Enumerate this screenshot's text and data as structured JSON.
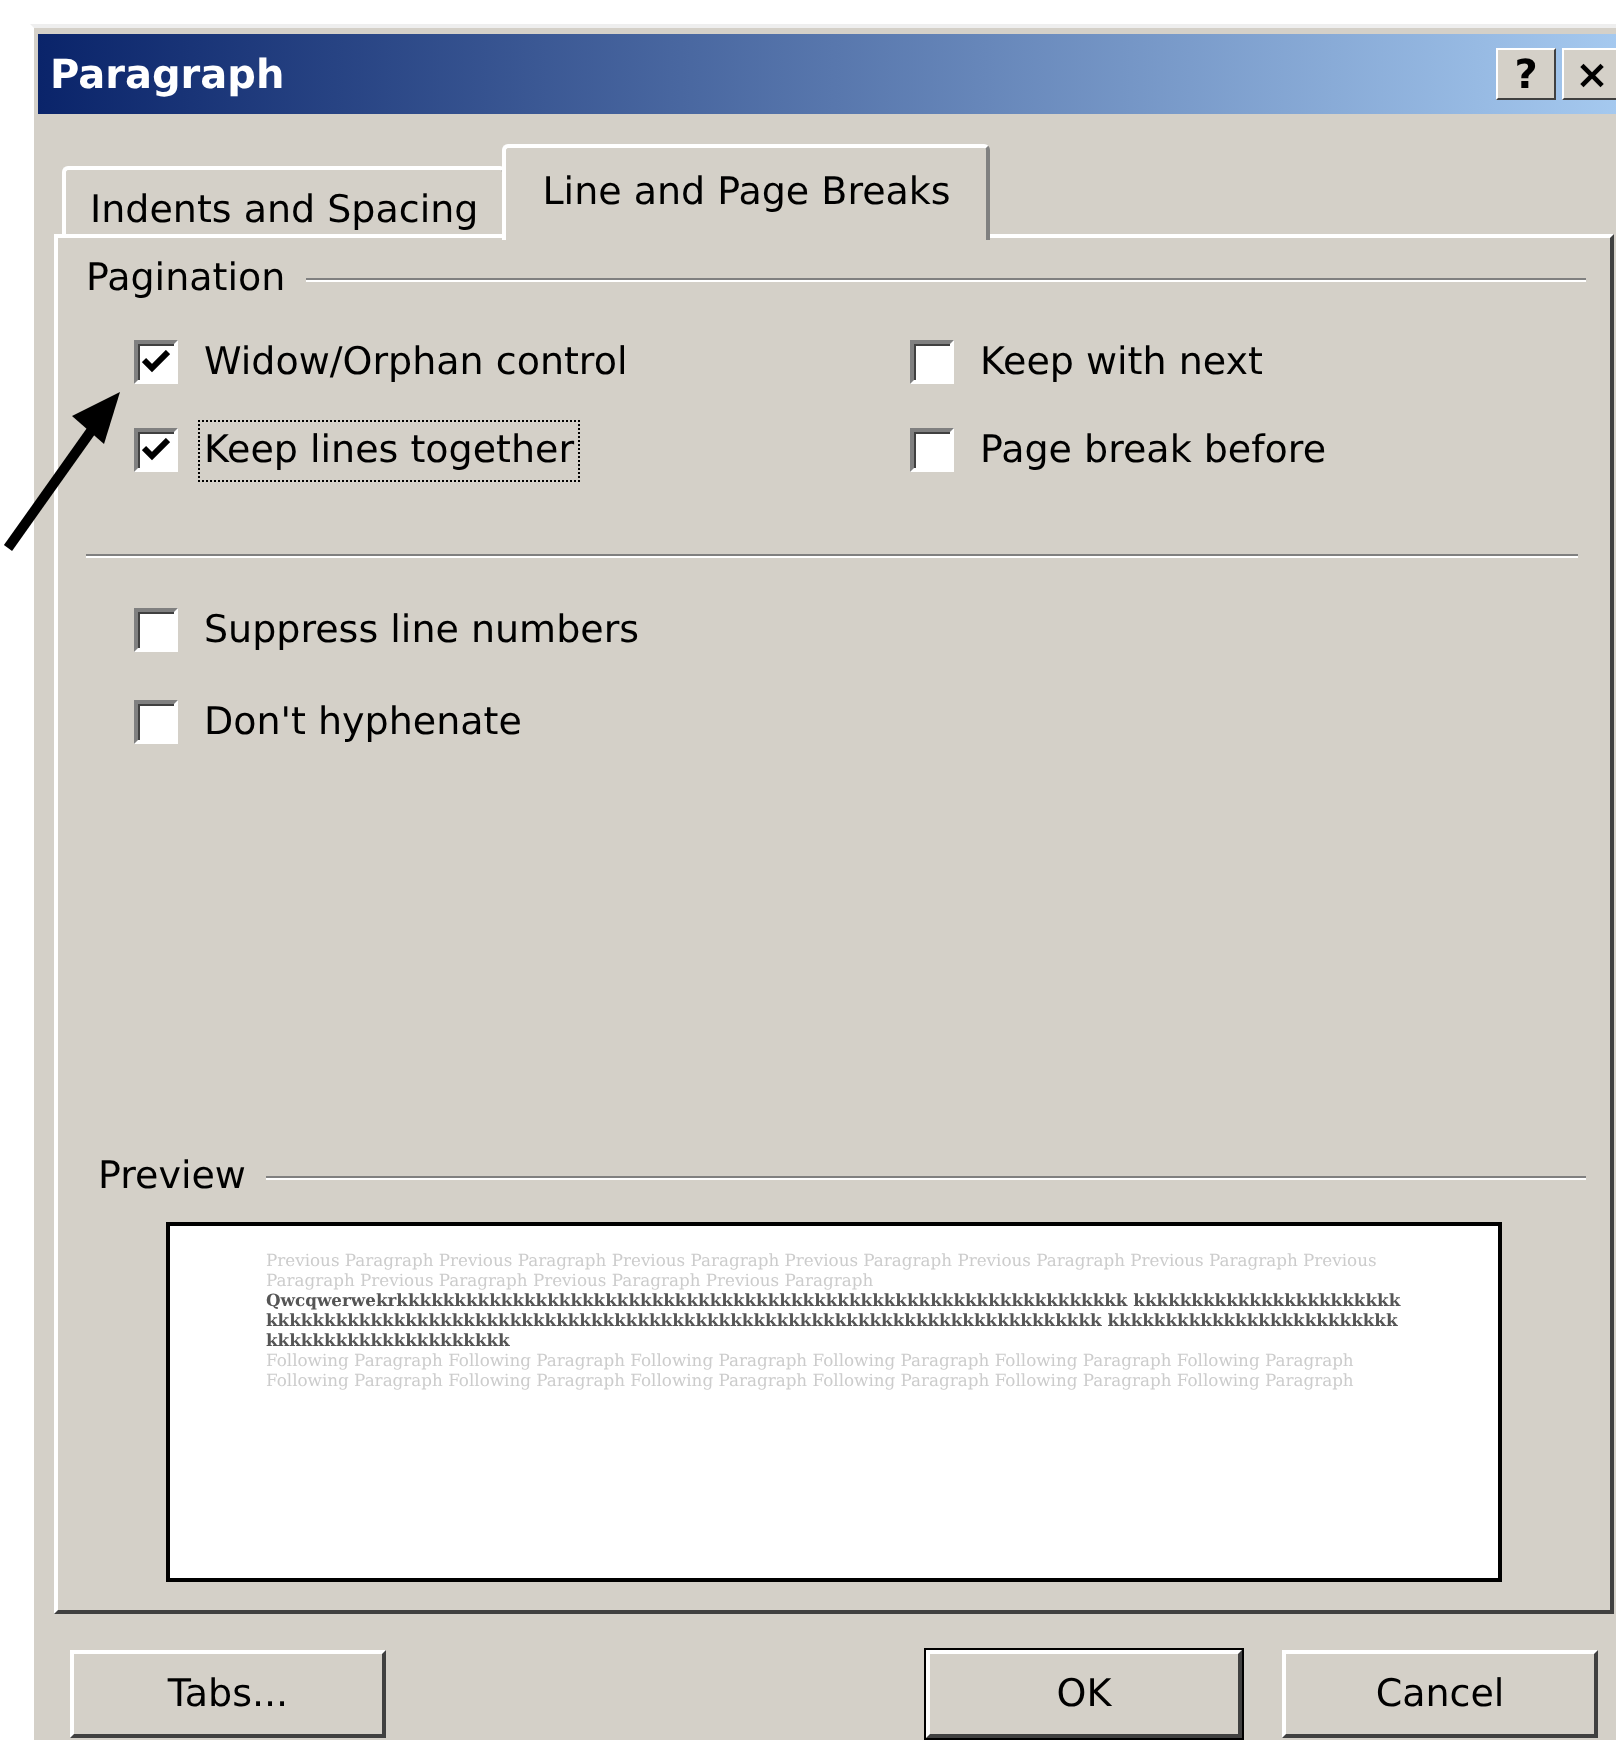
{
  "window": {
    "title": "Paragraph",
    "controls": [
      "?",
      "×"
    ]
  },
  "tabs": [
    {
      "label": "Indents and Spacing",
      "selected": false
    },
    {
      "label": "Line and Page Breaks",
      "selected": true
    }
  ],
  "pagination": {
    "title": "Pagination",
    "options": [
      {
        "label": "Widow/Orphan control",
        "checked": true,
        "focused": false
      },
      {
        "label": "Keep with next",
        "checked": false,
        "focused": false
      },
      {
        "label": "Keep lines together",
        "checked": true,
        "focused": true
      },
      {
        "label": "Page break before",
        "checked": false,
        "focused": false
      }
    ]
  },
  "other_options": [
    {
      "label": "Suppress line numbers",
      "checked": false,
      "focused": false
    },
    {
      "label": "Don't hyphenate",
      "checked": false,
      "focused": false
    }
  ],
  "preview": {
    "title": "Preview",
    "paragraphs": [
      {
        "kind": "previous",
        "text": "Previous Paragraph Previous Paragraph Previous Paragraph Previous Paragraph Previous Paragraph Previous Paragraph Previous Paragraph Previous Paragraph Previous Paragraph Previous Paragraph"
      },
      {
        "kind": "current",
        "text": "Qwcqwerwekrkkkkkkkkkkkkkkkkkkkkkkkkkkkkkkkkkkkkkkkkkkkkkkkkkkkkkkkkkkkkkkk kkkkkkkkkkkkkkkkkkkkkkkkkkkkkkkkkkkkkkkkkkkkkkkkkkkkkkkkkkkkkkkkkkkkkkkkkkkkkkkkkkkkkkkkkkkkkkk kkkkkkkkkkkkkkkkkkkkkkkkkkkkkkkkkkkkkkkkkkkkkk"
      },
      {
        "kind": "following",
        "text": "Following Paragraph Following Paragraph Following Paragraph Following Paragraph Following Paragraph Following Paragraph Following Paragraph Following Paragraph Following Paragraph Following Paragraph Following Paragraph Following Paragraph"
      }
    ]
  },
  "buttons": [
    {
      "label": "Tabs...",
      "default": false
    },
    {
      "label": "OK",
      "default": true
    },
    {
      "label": "Cancel",
      "default": false
    }
  ]
}
